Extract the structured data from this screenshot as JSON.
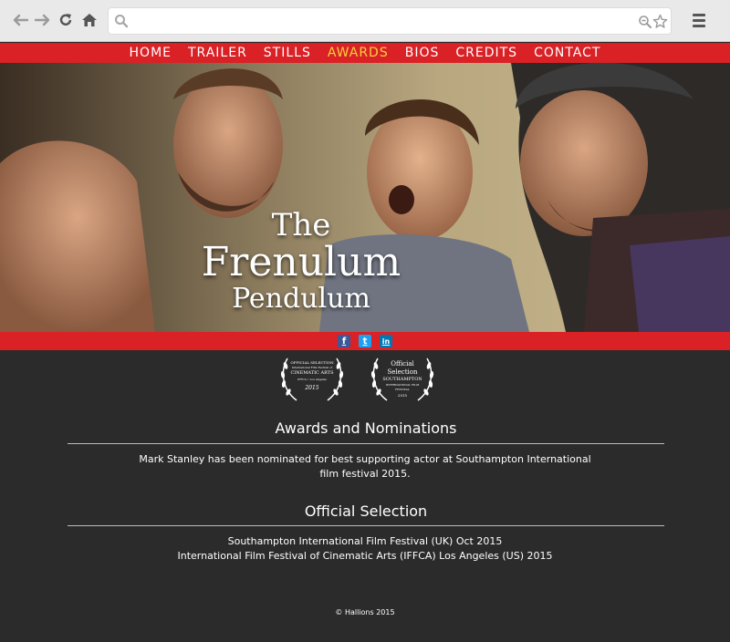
{
  "browser": {
    "back_icon": "arrow-left-icon",
    "forward_icon": "arrow-right-icon",
    "reload_icon": "reload-icon",
    "home_icon": "home-icon",
    "search_icon": "search-icon",
    "zoom_icon": "zoom-icon",
    "bookmark_icon": "star-icon",
    "menu_icon": "hamburger-icon",
    "address_value": ""
  },
  "nav": {
    "items": [
      {
        "label": "HOME"
      },
      {
        "label": "TRAILER"
      },
      {
        "label": "STILLS"
      },
      {
        "label": "AWARDS"
      },
      {
        "label": "BIOS"
      },
      {
        "label": "CREDITS"
      },
      {
        "label": "CONTACT"
      }
    ],
    "active": "AWARDS",
    "active_color": "#f5d33a",
    "bar_color": "#d92126"
  },
  "hero": {
    "title_line1": "The",
    "title_line2": "Frenulum",
    "title_line3": "Pendulum"
  },
  "social": {
    "facebook": "f",
    "twitter": "t",
    "linkedin": "in"
  },
  "laurels": [
    {
      "l1": "OFFICIAL SELECTION",
      "l2": "International Film Festival of",
      "l3": "CINEMATIC ARTS",
      "l4": "IFFCA • Los Angeles",
      "l5": "2015"
    },
    {
      "l1": "Official",
      "l2": "Selection",
      "l3": "SOUTHAMPTON",
      "l4": "INTERNATIONAL FILM FESTIVAL",
      "l5": "2015"
    }
  ],
  "awards": {
    "heading": "Awards and Nominations",
    "text": "Mark Stanley has been nominated for best supporting actor at Southampton International film festival 2015."
  },
  "selection": {
    "heading": "Official Selection",
    "line1": "Southampton International Film Festival (UK) Oct 2015",
    "line2": "International Film Festival of Cinematic Arts (IFFCA) Los Angeles (US) 2015"
  },
  "footer": {
    "text": "© Hallions 2015"
  }
}
